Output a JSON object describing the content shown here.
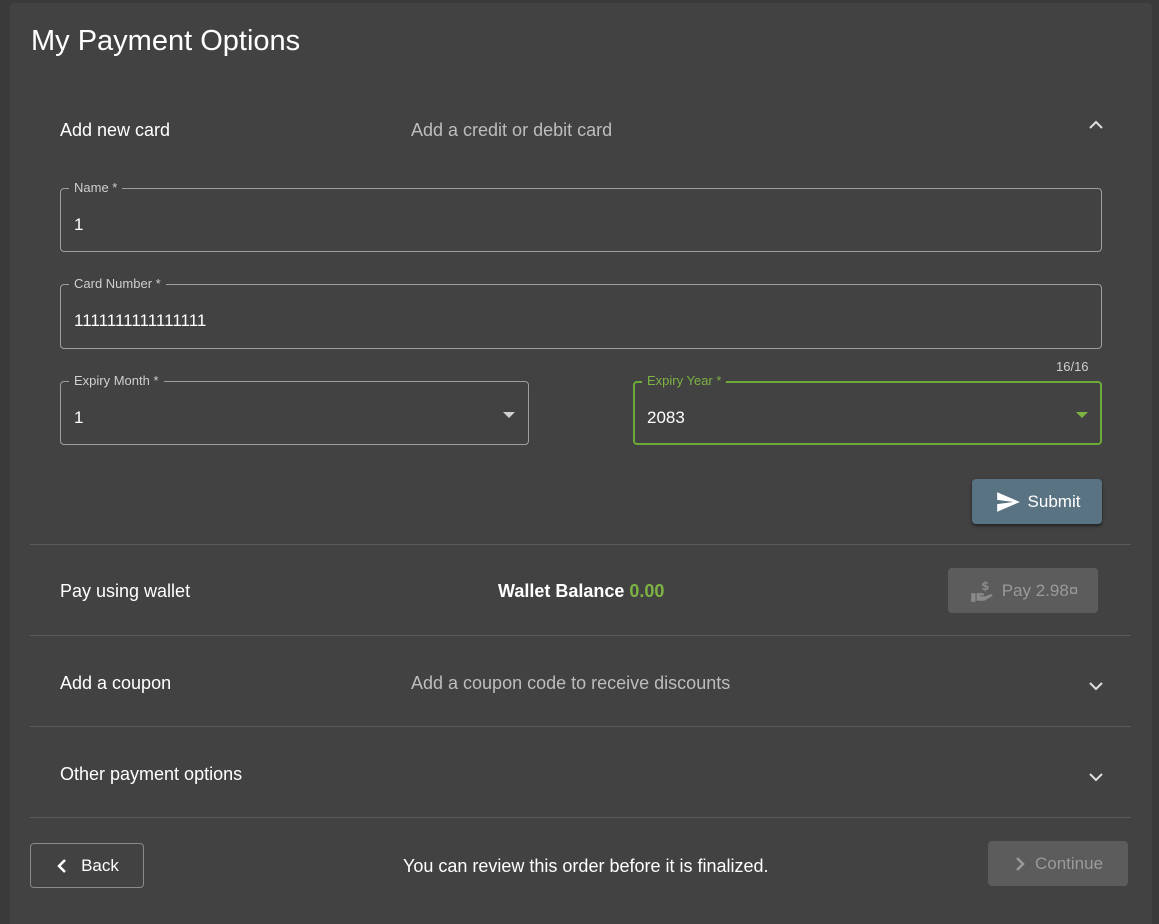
{
  "page": {
    "title": "My Payment Options"
  },
  "add_card": {
    "title": "Add new card",
    "subtitle": "Add a credit or debit card",
    "name_label": "Name *",
    "name_value": "1",
    "card_number_label": "Card Number *",
    "card_number_value": "1111111111111111",
    "card_number_counter": "16/16",
    "expiry_month_label": "Expiry Month *",
    "expiry_month_value": "1",
    "expiry_year_label": "Expiry Year *",
    "expiry_year_value": "2083",
    "submit_label": "Submit"
  },
  "wallet": {
    "title": "Pay using wallet",
    "balance_label": "Wallet Balance",
    "balance_value": "0.00",
    "pay_label": "Pay 2.98¤"
  },
  "coupon": {
    "title": "Add a coupon",
    "subtitle": "Add a coupon code to receive discounts"
  },
  "other": {
    "title": "Other payment options"
  },
  "footer": {
    "back_label": "Back",
    "note": "You can review this order before it is finalized.",
    "continue_label": "Continue"
  },
  "colors": {
    "background": "#424242",
    "accent_green": "#7cb342",
    "submit_button": "#5a7382"
  }
}
